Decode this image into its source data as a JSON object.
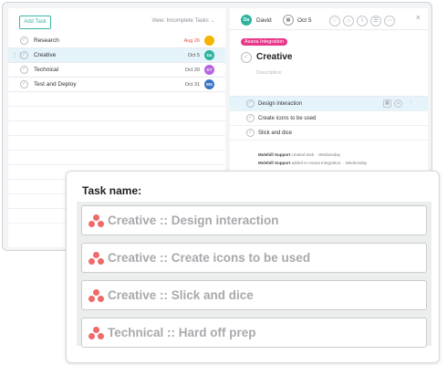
{
  "left_panel": {
    "add_task_label": "Add Task",
    "view_filter_label": "View: Incomplete Tasks",
    "tasks": [
      {
        "name": "Research",
        "date": "Aug 26",
        "date_overdue": true,
        "avatar_initials": "",
        "avatar_color": "#f4b400"
      },
      {
        "name": "Creative",
        "date": "Oct 5",
        "date_overdue": false,
        "avatar_initials": "Da",
        "avatar_color": "#2db39e",
        "selected": true
      },
      {
        "name": "Technical",
        "date": "Oct 20",
        "date_overdue": false,
        "avatar_initials": "KT",
        "avatar_color": "#b663e0"
      },
      {
        "name": "Test and Deploy",
        "date": "Oct 31",
        "date_overdue": false,
        "avatar_initials": "MS",
        "avatar_color": "#3a74c4"
      }
    ]
  },
  "detail_panel": {
    "assignee_initials": "Da",
    "assignee_name": "David",
    "due_date": "Oct 5",
    "tag": "Asana Integration",
    "title": "Creative",
    "description_placeholder": "Description",
    "subtasks": [
      {
        "name": "Design interaction",
        "highlighted": true
      },
      {
        "name": "Create icons to be used",
        "highlighted": false
      },
      {
        "name": "Slick and dice",
        "highlighted": false
      }
    ],
    "activity": [
      {
        "actor": "Molehill Support",
        "action": "created task.",
        "time": "Wednesday"
      },
      {
        "actor": "Molehill Support",
        "action": "added to Asana Integration.",
        "time": "Wednesday"
      }
    ],
    "colors": {
      "accent": "#3cb6a8",
      "tag": "#e8388a"
    }
  },
  "popup": {
    "label": "Task name:",
    "items": [
      "Creative :: Design interaction",
      "Creative :: Create icons to be used",
      "Creative :: Slick and dice",
      "Technical :: Hard off prep"
    ],
    "logo_color": "#f06a6a"
  }
}
